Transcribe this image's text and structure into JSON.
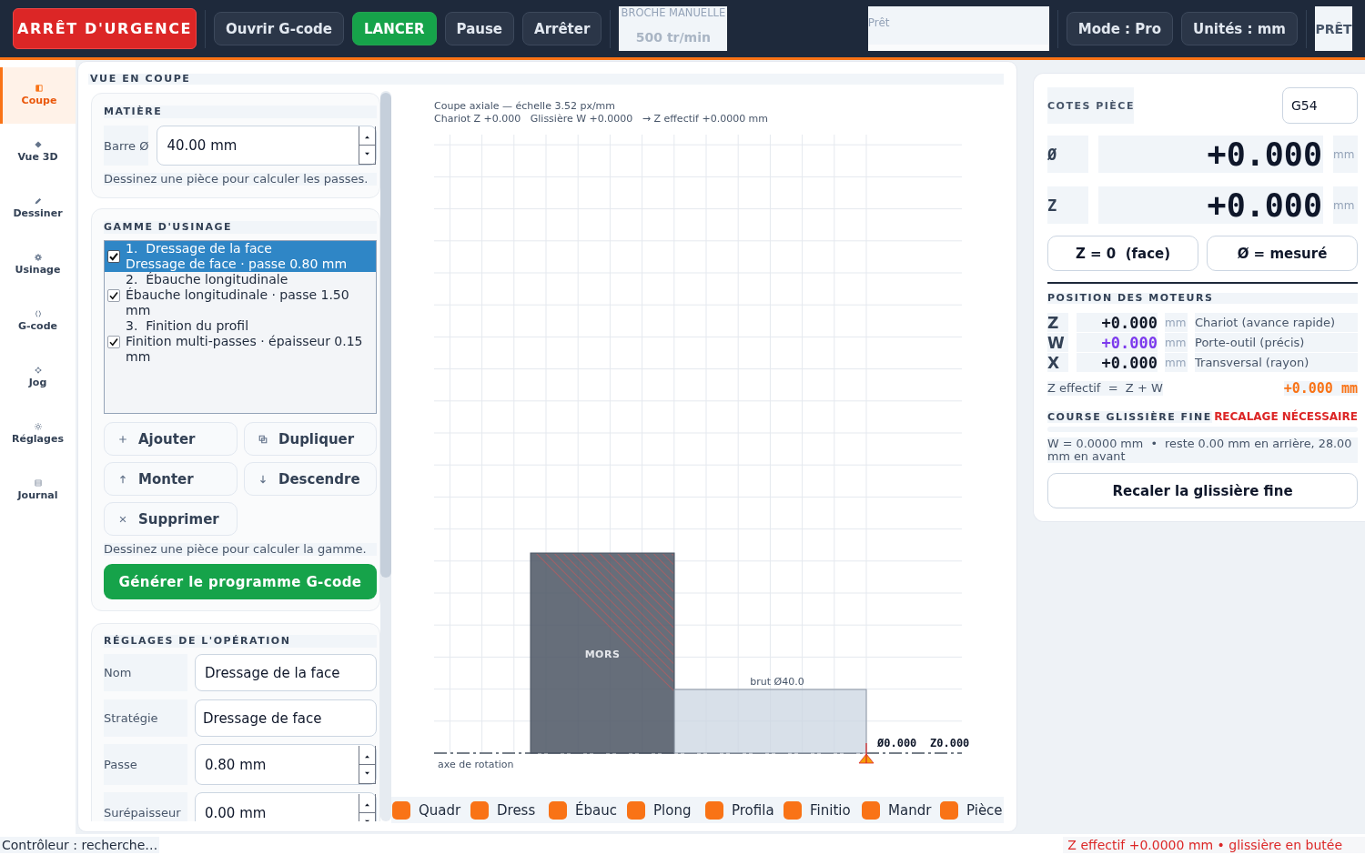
{
  "toolbar": {
    "emergency_stop": "ARRÊT D'URGENCE",
    "buttons": [
      {
        "label": "Ouvrir G-code",
        "kind": "default"
      },
      {
        "label": "LANCER",
        "kind": "primary"
      },
      {
        "label": "Pause",
        "kind": "default"
      },
      {
        "label": "Arrêter",
        "kind": "default"
      }
    ],
    "spindle": {
      "label": "BROCHE MANUELLE",
      "value": "500 tr/min",
      "disabled": true
    },
    "status_field": {
      "value": "Prêt"
    },
    "mode_buttons": [
      "Mode : Pro",
      "Unités : mm"
    ],
    "state_badge": "PRÊT"
  },
  "sidebar": {
    "items": [
      {
        "label": "Coupe",
        "selected": true
      },
      {
        "label": "Vue 3D",
        "selected": false
      },
      {
        "label": "Dessiner",
        "selected": false
      },
      {
        "label": "Usinage",
        "selected": false
      },
      {
        "label": "G-code",
        "selected": false
      },
      {
        "label": "Jog",
        "selected": false
      },
      {
        "label": "Réglages",
        "selected": false
      },
      {
        "label": "Journal",
        "selected": false
      }
    ]
  },
  "view": {
    "title": "VUE EN COUPE"
  },
  "material": {
    "title": "MATIÈRE",
    "bar_label": "Barre Ø",
    "bar_value": "40.00 mm",
    "hint": "Dessinez une pièce pour calculer les passes."
  },
  "routing": {
    "title": "GAMME D'USINAGE",
    "operations": [
      {
        "title": "1.  Dressage de la face",
        "detail": "Dressage de face · passe 0.80 mm",
        "checked": true,
        "selected": true
      },
      {
        "title": "2.  Ébauche longitudinale",
        "detail": "Ébauche longitudinale · passe 1.50 mm",
        "checked": true,
        "selected": false
      },
      {
        "title": "3.  Finition du profil",
        "detail": "Finition multi-passes · épaisseur 0.15 mm",
        "checked": true,
        "selected": false
      }
    ],
    "buttons": [
      "Ajouter",
      "Dupliquer",
      "Monter",
      "Descendre",
      "Supprimer"
    ],
    "hint": "Dessinez une pièce pour calculer la gamme.",
    "generate_button": "Générer le programme G-code"
  },
  "operation_settings": {
    "title": "RÉGLAGES DE L'OPÉRATION",
    "fields": [
      {
        "label": "Nom",
        "value": "Dressage de la face",
        "kind": "text"
      },
      {
        "label": "Stratégie",
        "value": "Dressage de face",
        "kind": "select"
      },
      {
        "label": "Passe",
        "value": "0.80 mm",
        "kind": "number"
      },
      {
        "label": "Surépaisseur",
        "value": "0.00 mm",
        "kind": "number"
      }
    ]
  },
  "section_view": {
    "caption": "Coupe axiale — échelle 3.52 px/mm",
    "readout": "Chariot Z +0.000   Glissière W +0.0000   → Z effectif +0.0000 mm",
    "jaw_label": "MORS",
    "stock_label": "brut Ø40.0",
    "origin_diameter": "Ø0.000",
    "origin_z": "Z0.000",
    "axis_label": "axe de rotation",
    "legend": [
      "Quadr",
      "Dress",
      "Ébauc",
      "Plong",
      "Profila",
      "Finitio",
      "Mandr",
      "Pièce"
    ]
  },
  "part_dimensions": {
    "title": "COTES PIÈCE",
    "work_offset": "G54",
    "readouts": [
      {
        "axis": "Ø",
        "value": "+0.000",
        "unit": "mm"
      },
      {
        "axis": "Z",
        "value": "+0.000",
        "unit": "mm"
      }
    ],
    "buttons": [
      "Z = 0  (face)",
      "Ø = mesuré"
    ]
  },
  "motors": {
    "title": "POSITION DES MOTEURS",
    "axes": [
      {
        "axis": "Z",
        "value": "+0.000",
        "unit": "mm",
        "description": "Chariot (avance rapide)",
        "color": "#111827"
      },
      {
        "axis": "W",
        "value": "+0.000",
        "unit": "mm",
        "description": "Porte-outil (précis)",
        "color": "#7c3aed"
      },
      {
        "axis": "X",
        "value": "+0.000",
        "unit": "mm",
        "description": "Transversal (rayon)",
        "color": "#111827"
      }
    ],
    "effective_label": "Z effectif  =  Z + W",
    "effective_value": "+0.000 mm"
  },
  "fine_slide": {
    "title": "COURSE GLISSIÈRE FINE",
    "alert": "RECALAGE NÉCESSAIRE",
    "info": "W = 0.0000 mm  •  reste 0.00 mm en arrière, 28.00 mm en avant",
    "button": "Recaler la glissière fine"
  },
  "status_bar": {
    "left": "Contrôleur : recherche…",
    "right": "Z effectif +0.0000 mm  •  glissière en butée"
  }
}
